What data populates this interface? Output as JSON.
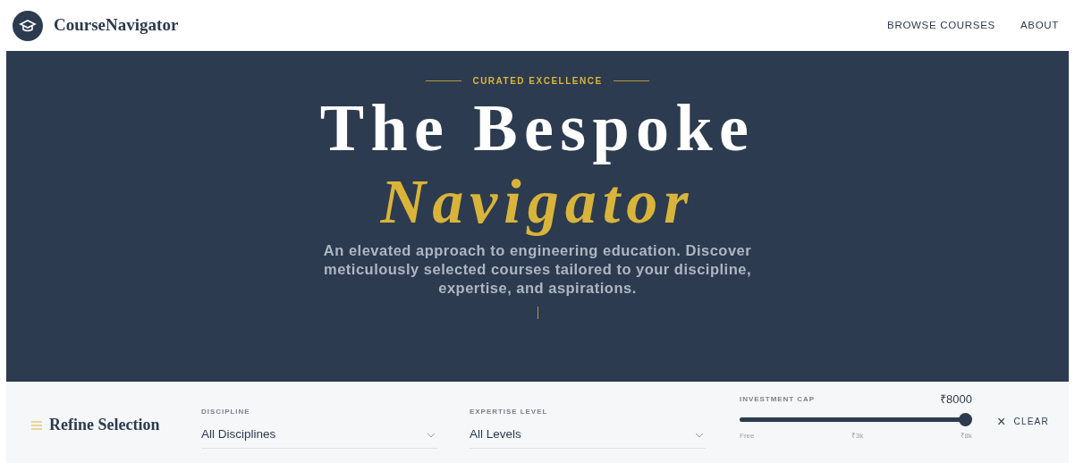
{
  "header": {
    "brand": "CourseNavigator",
    "nav": [
      {
        "label": "BROWSE COURSES"
      },
      {
        "label": "ABOUT"
      }
    ]
  },
  "hero": {
    "eyebrow": "CURATED EXCELLENCE",
    "title_line_1": "The Bespoke",
    "title_line_2": "Navigator",
    "subtitle": "An elevated approach to engineering education. Discover meticulously selected courses tailored to your discipline, expertise, and aspirations."
  },
  "filters": {
    "title": "Refine Selection",
    "selects": [
      {
        "label": "DISCIPLINE",
        "value": "All Disciplines"
      },
      {
        "label": "EXPERTISE LEVEL",
        "value": "All Levels"
      }
    ],
    "investment": {
      "label": "INVESTMENT CAP",
      "reading": "₹8000",
      "level": 1.0,
      "ticks": [
        "Free",
        "₹3k",
        "₹8k"
      ]
    },
    "clear": {
      "icon": "×",
      "label": "CLEAR"
    }
  }
}
